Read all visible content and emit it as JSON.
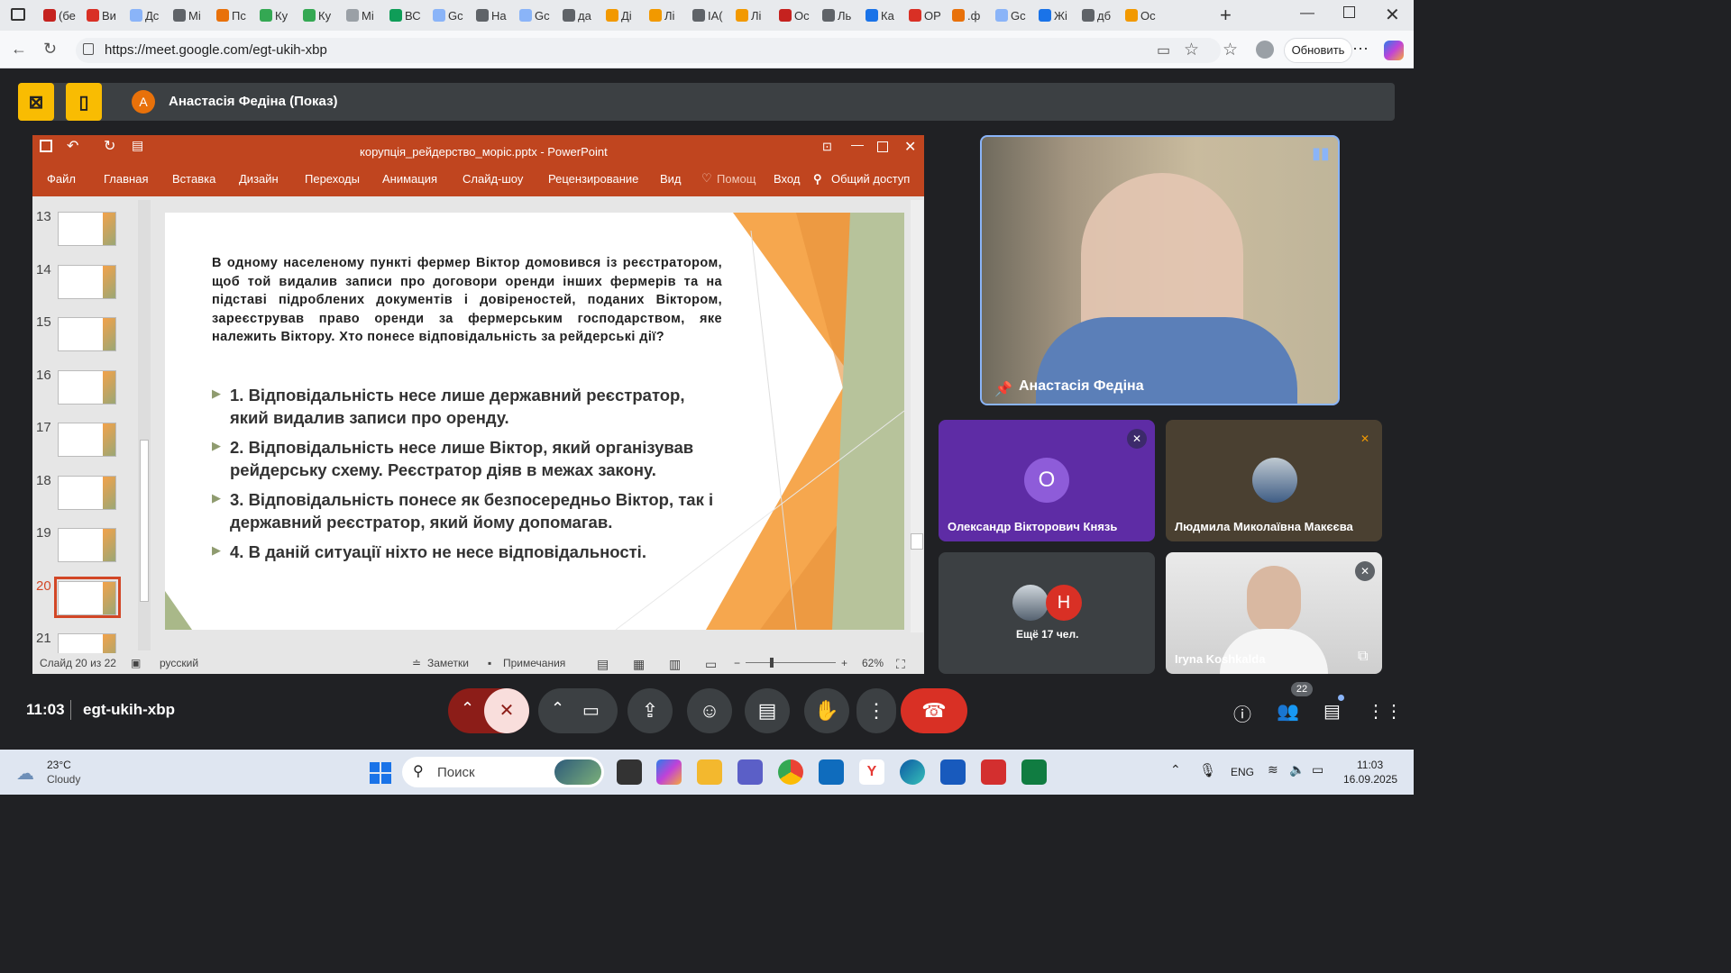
{
  "browser": {
    "tab_labels": [
      "(бе",
      "Ви",
      "Дс",
      "Мі",
      "Пс",
      "Ку",
      "Ку",
      "Мі",
      "ВС",
      "Gc",
      "На",
      "Gc",
      "да",
      "Ді",
      "Лі",
      "ІА(",
      "Лі",
      "Ос",
      "Ль",
      "Ка",
      "ОР",
      ".ф",
      "Gc",
      "Жі",
      "дб",
      "Ос"
    ],
    "url": "https://meet.google.com/egt-ukih-xbp",
    "update_label": "Обновить"
  },
  "meet": {
    "presenter_initial": "A",
    "presenter_title": "Анастасія Федіна (Показ)",
    "time": "11:03",
    "meeting_code": "egt-ukih-xbp",
    "participant_count": "22",
    "tiles": {
      "main": {
        "name": "Анастасія Федіна"
      },
      "t1": {
        "initial": "O",
        "name": "Олександр Вікторович Князь"
      },
      "t2": {
        "name": "Людмила Миколаївна Макєєва"
      },
      "t3": {
        "initial": "H",
        "label": "Ещё 17 чел."
      },
      "t4": {
        "name": "Iryna Koshkalda"
      }
    }
  },
  "ppt": {
    "title": "корупція_рейдерство_моріс.pptx - PowerPoint",
    "tabs": [
      "Файл",
      "Главная",
      "Вставка",
      "Дизайн",
      "Переходы",
      "Анимация",
      "Слайд-шоу",
      "Рецензирование",
      "Вид"
    ],
    "help": "Помощ",
    "login": "Вход",
    "share": "Общий доступ",
    "slide_numbers": [
      "13",
      "14",
      "15",
      "16",
      "17",
      "18",
      "19",
      "20",
      "21"
    ],
    "status": {
      "slide_info": "Слайд 20 из 22",
      "language": "русский",
      "notes": "Заметки",
      "comments": "Примечания",
      "zoom": "62%"
    },
    "slide": {
      "question": "В одному населеному пункті фермер Віктор домовився із реєстратором, щоб той видалив записи про договори оренди інших фермерів та на підставі підроблених документів і довіреностей, поданих Віктором, зареєстрував право оренди за фермерським господарством, яке належить Віктору. Хто понесе відповідальність за рейдерські дії?",
      "options": [
        "1. Відповідальність несе лише державний реєстратор, який видалив записи про оренду.",
        "2. Відповідальність несе лише Віктор, який організував рейдерську схему. Реєстратор діяв в межах закону.",
        "3. Відповідальність понесе як безпосередньо Віктор, так і державний реєстратор, який йому допомагав.",
        "4. В даній ситуації ніхто не несе відповідальності."
      ]
    }
  },
  "taskbar": {
    "temp": "23°C",
    "weather": "Cloudy",
    "search": "Поиск",
    "lang": "ENG",
    "time": "11:03",
    "date": "16.09.2025"
  }
}
